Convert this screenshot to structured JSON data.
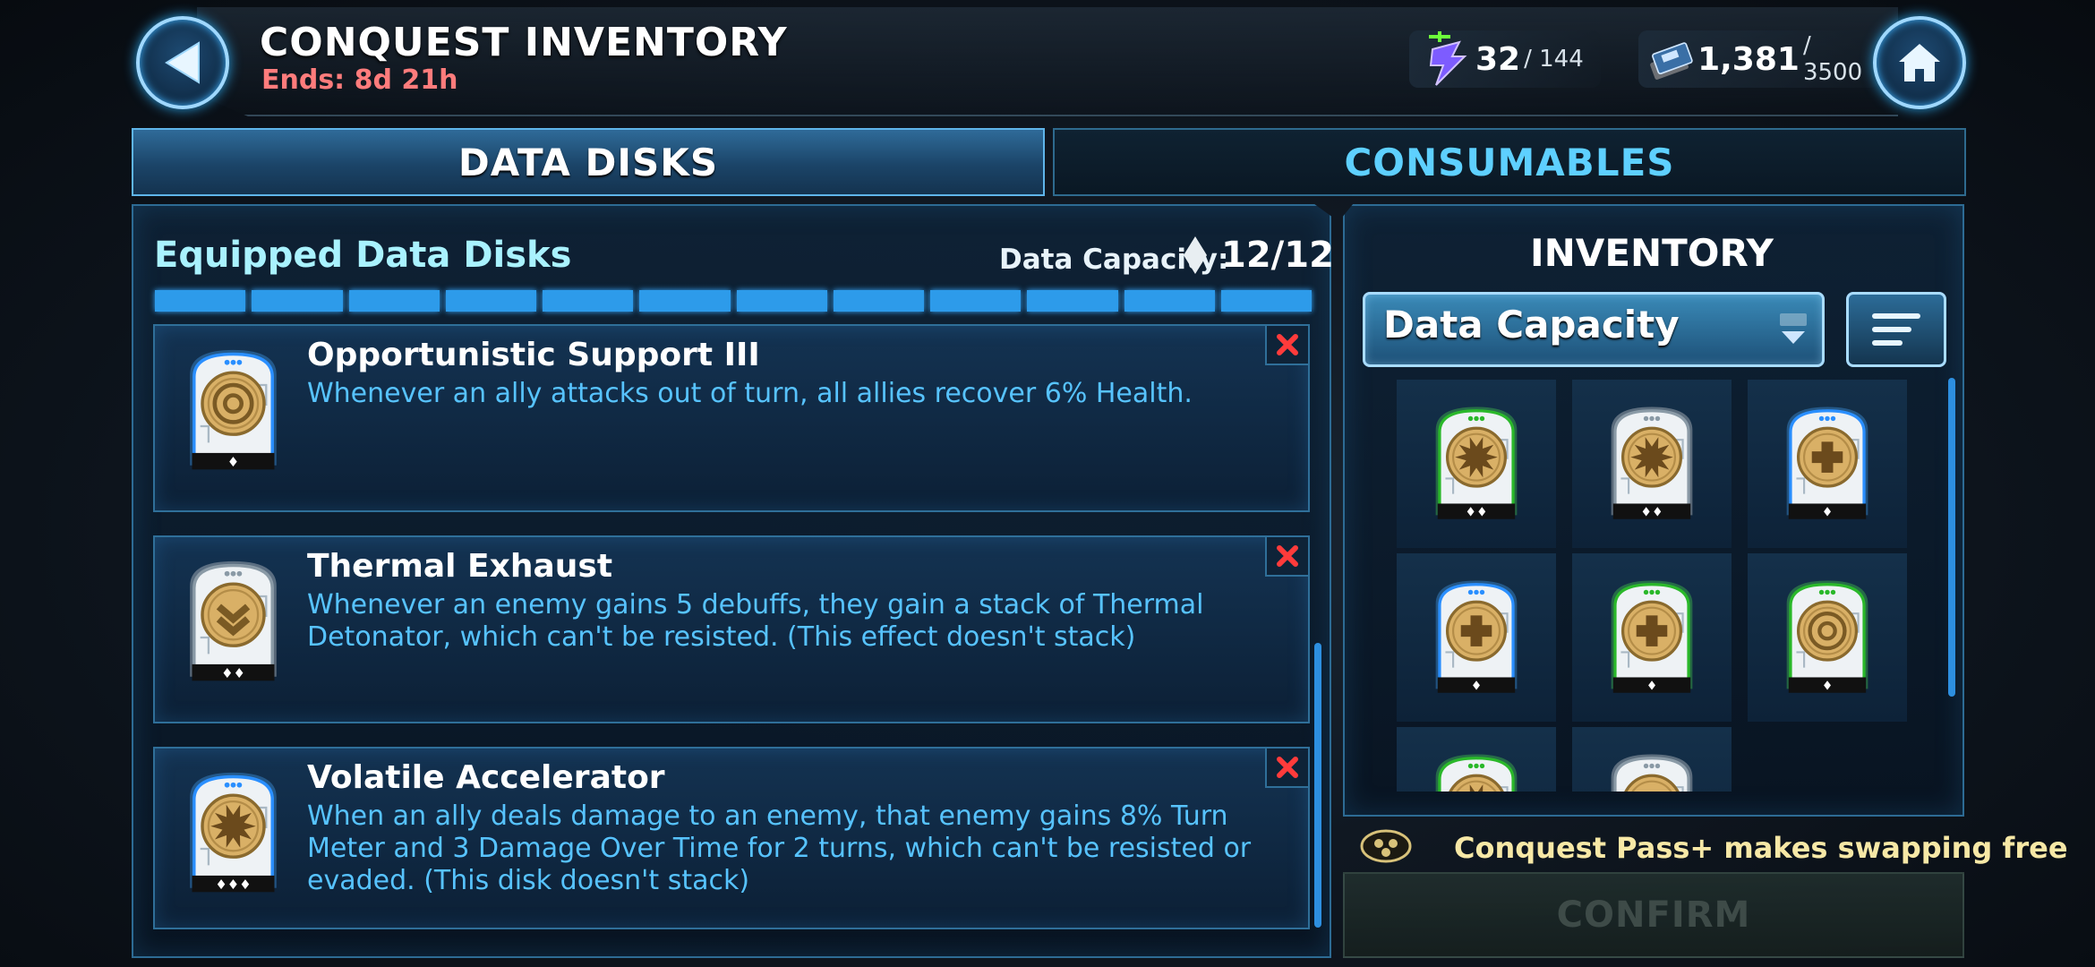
{
  "header": {
    "title": "CONQUEST INVENTORY",
    "ends": "Ends: 8d 21h",
    "energy": {
      "value": "32",
      "max": "/ 144",
      "icon": "conquest-energy-icon"
    },
    "disks": {
      "value": "1,381",
      "max": "/ 3500",
      "icon": "conquest-credits-icon"
    }
  },
  "tabs": [
    {
      "label": "DATA DISKS",
      "active": true
    },
    {
      "label": "CONSUMABLES",
      "active": false
    }
  ],
  "equipped": {
    "title": "Equipped Data Disks",
    "capacity_label": "Data Capacity:",
    "capacity_value": "12/12",
    "capacity_used": 12,
    "capacity_max": 12,
    "disks": [
      {
        "name": "Opportunistic Support III",
        "description": "Whenever an ally attacks out of turn, all allies recover 6% Health.",
        "symbol": "rings",
        "frame": "blue",
        "pips": "♦"
      },
      {
        "name": "Thermal Exhaust",
        "description": "Whenever an enemy gains 5 debuffs, they gain a stack of Thermal Detonator, which can't be resisted. (This effect doesn't stack)",
        "symbol": "chevron",
        "frame": "white",
        "pips": "♦♦"
      },
      {
        "name": "Volatile Accelerator",
        "description": "When an ally deals damage to an enemy, that enemy gains 8% Turn Meter and 3 Damage Over Time for 2 turns, which can't be resisted or evaded. (This disk doesn't stack)",
        "symbol": "burst",
        "frame": "blue",
        "pips": "♦♦♦"
      }
    ]
  },
  "inventory": {
    "title": "INVENTORY",
    "sort_label": "Data Capacity",
    "items": [
      {
        "symbol": "burst",
        "frame": "green",
        "pips": "♦♦"
      },
      {
        "symbol": "burst",
        "frame": "white",
        "pips": "♦♦"
      },
      {
        "symbol": "cross",
        "frame": "blue",
        "pips": "♦"
      },
      {
        "symbol": "cross",
        "frame": "blue",
        "pips": "♦"
      },
      {
        "symbol": "cross",
        "frame": "green",
        "pips": "♦"
      },
      {
        "symbol": "rings",
        "frame": "green",
        "pips": "♦"
      },
      {
        "symbol": "burst",
        "frame": "green",
        "pips": ""
      },
      {
        "symbol": "chevron",
        "frame": "white",
        "pips": ""
      }
    ]
  },
  "pass_note": "Conquest Pass+ makes swapping free",
  "confirm_label": "CONFIRM",
  "colors": {
    "accent": "#2d9bea",
    "desc_text": "#57c3ff",
    "title_text": "#a9f2ff",
    "ends_text": "#ff7c7c",
    "green_frame": "#4ce04c",
    "blue_frame": "#49a8ff",
    "white_frame": "#e6e6e6"
  }
}
